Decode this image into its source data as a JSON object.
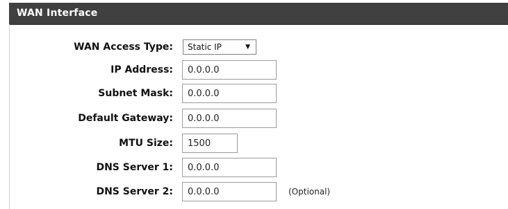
{
  "header": {
    "title": "WAN Interface"
  },
  "fields": {
    "access_type": {
      "label": "WAN Access Type:",
      "value": "Static IP"
    },
    "ip_address": {
      "label": "IP Address:",
      "value": "0.0.0.0"
    },
    "subnet_mask": {
      "label": "Subnet Mask:",
      "value": "0.0.0.0"
    },
    "default_gateway": {
      "label": "Default Gateway:",
      "value": "0.0.0.0"
    },
    "mtu_size": {
      "label": "MTU Size:",
      "value": "1500"
    },
    "dns_server_1": {
      "label": "DNS Server 1:",
      "value": "0.0.0.0"
    },
    "dns_server_2": {
      "label": "DNS Server 2:",
      "value": "0.0.0.0",
      "note": "(Optional)"
    }
  },
  "icons": {
    "dropdown_arrow": "chevron-down-icon"
  },
  "colors": {
    "header_bg": "#404040",
    "header_text": "#ffffff"
  }
}
